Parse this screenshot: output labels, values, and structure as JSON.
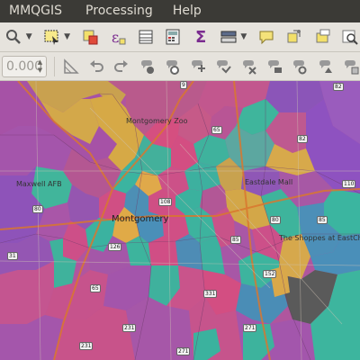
{
  "menu": {
    "items": [
      "MMQGIS",
      "Processing",
      "Help"
    ]
  },
  "toolbar1": {
    "icons": [
      "zoom-pan-icon",
      "select-features-icon",
      "deselect-icon",
      "expression-select-icon",
      "attribute-table-icon",
      "field-calculator-icon",
      "statistics-sum-icon",
      "layer-tools-icon",
      "annotation-icon",
      "digitize-icon",
      "new-layer-icon",
      "search-icon"
    ]
  },
  "toolbar2": {
    "spin_value": "0.000",
    "icons": [
      "snapping-icon",
      "undo-icon",
      "redo-icon",
      "label-pin-icon",
      "label-rotate-icon",
      "label-move-icon",
      "label-show-icon",
      "label-hide-icon",
      "label-change-icon",
      "label-props-icon",
      "label-diagram-icon",
      "label-extra-icon"
    ]
  },
  "map": {
    "labels": {
      "zoo": "Montgomery Zoo",
      "maxwell": "Maxwell AFB",
      "eastdale": "Eastdale Mall",
      "city": "Montgomery",
      "shoppes": "The Shoppes at EastChase"
    },
    "route_shields": [
      "31",
      "231",
      "9",
      "65",
      "80",
      "231",
      "85",
      "82",
      "80",
      "65",
      "85",
      "331",
      "82",
      "271",
      "126",
      "108",
      "152",
      "110",
      "271"
    ]
  }
}
